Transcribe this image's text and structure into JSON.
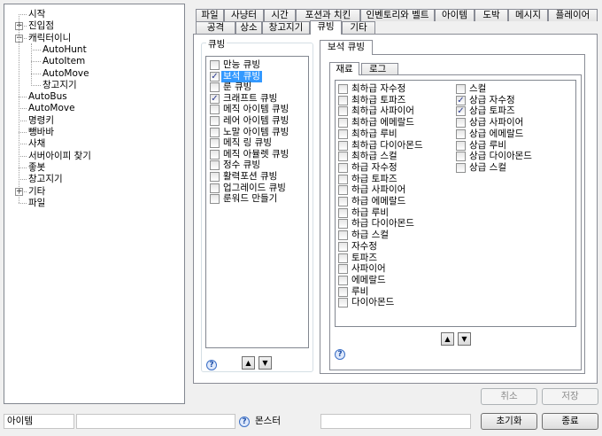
{
  "tree": {
    "items": [
      {
        "label": "시작",
        "expander": ""
      },
      {
        "label": "진입점",
        "expander": "+"
      },
      {
        "label": "캐릭터이니",
        "expander": "−"
      },
      {
        "label": "AutoHunt",
        "expander": ""
      },
      {
        "label": "AutoItem",
        "expander": ""
      },
      {
        "label": "AutoMove",
        "expander": ""
      },
      {
        "label": "창고지기",
        "expander": ""
      },
      {
        "label": "AutoBus",
        "expander": ""
      },
      {
        "label": "AutoMove",
        "expander": ""
      },
      {
        "label": "명령키",
        "expander": ""
      },
      {
        "label": "뺑바바",
        "expander": ""
      },
      {
        "label": "사채",
        "expander": ""
      },
      {
        "label": "서버아이피 찾기",
        "expander": ""
      },
      {
        "label": "좋봇",
        "expander": ""
      },
      {
        "label": "창고지기",
        "expander": ""
      },
      {
        "label": "기타",
        "expander": "+"
      },
      {
        "label": "파일",
        "expander": ""
      }
    ]
  },
  "tabs_row1": [
    "파일",
    "사냥터",
    "시간",
    "포션과 치킨",
    "인벤토리와 벨트",
    "아이템",
    "도박",
    "메시지",
    "플레이어"
  ],
  "tabs_row2": [
    "공격",
    "상소",
    "창고지기",
    "큐빙",
    "기타"
  ],
  "active_tab": "큐빙",
  "cubing_group": {
    "title": "큐빙",
    "items": [
      {
        "label": "만능 큐빙",
        "checked": false
      },
      {
        "label": "보석 큐빙",
        "checked": true,
        "selected": true
      },
      {
        "label": "룬 큐빙",
        "checked": false
      },
      {
        "label": "크래프트 큐빙",
        "checked": true
      },
      {
        "label": "메직 아이템 큐빙",
        "checked": false
      },
      {
        "label": "레어 아이템 큐빙",
        "checked": false
      },
      {
        "label": "노말 아이템 큐빙",
        "checked": false
      },
      {
        "label": "메직 링 큐빙",
        "checked": false
      },
      {
        "label": "메직 아뮬렛 큐빙",
        "checked": false
      },
      {
        "label": "정수 큐빙",
        "checked": false
      },
      {
        "label": "활력포션 큐빙",
        "checked": false
      },
      {
        "label": "업그레이드 큐빙",
        "checked": false
      },
      {
        "label": "룬워드 만들기",
        "checked": false
      }
    ],
    "up_icon": "▲",
    "down_icon": "▼",
    "help_icon": "?"
  },
  "gem_panel": {
    "tab_label": "보석 큐빙",
    "subtabs": [
      "재료",
      "로그"
    ],
    "col1": [
      {
        "label": "최하급 자수정",
        "checked": false
      },
      {
        "label": "최하급 토파즈",
        "checked": false
      },
      {
        "label": "최하급 사파이어",
        "checked": false
      },
      {
        "label": "최하급 에메랄드",
        "checked": false
      },
      {
        "label": "최하급 루비",
        "checked": false
      },
      {
        "label": "최하급 다이아몬드",
        "checked": false
      },
      {
        "label": "최하급 스컬",
        "checked": false
      },
      {
        "label": "하급 자수정",
        "checked": false
      },
      {
        "label": "하급 토파즈",
        "checked": false
      },
      {
        "label": "하급 사파이어",
        "checked": false
      },
      {
        "label": "하급 에메랄드",
        "checked": false
      },
      {
        "label": "하급 루비",
        "checked": false
      },
      {
        "label": "하급 다이아몬드",
        "checked": false
      },
      {
        "label": "하급 스컬",
        "checked": false
      },
      {
        "label": "자수정",
        "checked": false
      },
      {
        "label": "토파즈",
        "checked": false
      },
      {
        "label": "사파이어",
        "checked": false
      },
      {
        "label": "에메랄드",
        "checked": false
      },
      {
        "label": "루비",
        "checked": false
      },
      {
        "label": "다이아몬드",
        "checked": false
      }
    ],
    "col2": [
      {
        "label": "스컬",
        "checked": false
      },
      {
        "label": "상급 자수정",
        "checked": true
      },
      {
        "label": "상급 토파즈",
        "checked": true
      },
      {
        "label": "상급 사파이어",
        "checked": false
      },
      {
        "label": "상급 에메랄드",
        "checked": false
      },
      {
        "label": "상급 루비",
        "checked": false
      },
      {
        "label": "상급 다이아몬드",
        "checked": false
      },
      {
        "label": "상급 스컬",
        "checked": false
      }
    ],
    "up_icon": "▲",
    "down_icon": "▼",
    "help_icon": "?"
  },
  "buttons": {
    "cancel": "취소",
    "save": "저장",
    "reset": "초기화",
    "exit": "종료"
  },
  "status": {
    "left": "아이템",
    "monster_icon": "?",
    "monster": "몬스터"
  }
}
